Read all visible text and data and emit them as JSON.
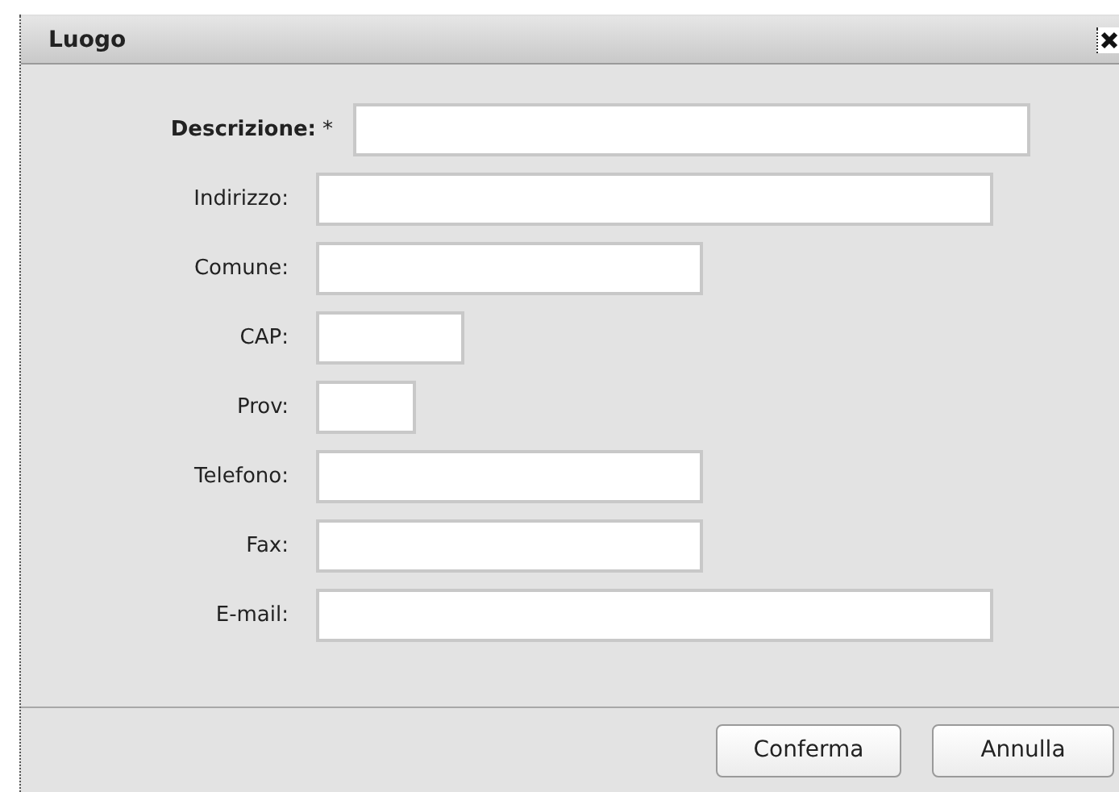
{
  "window": {
    "title": "Luogo"
  },
  "fields": [
    {
      "label": "Descrizione:",
      "required": true,
      "required_mark": "*",
      "kind": "wide"
    },
    {
      "label": "Indirizzo:",
      "required": false,
      "kind": "wide"
    },
    {
      "label": "Comune:",
      "required": false,
      "kind": "medium"
    },
    {
      "label": "CAP:",
      "required": false,
      "kind": "small"
    },
    {
      "label": "Prov:",
      "required": false,
      "kind": "tiny"
    },
    {
      "label": "Telefono:",
      "required": false,
      "kind": "medium"
    },
    {
      "label": "Fax:",
      "required": false,
      "kind": "medium"
    },
    {
      "label": "E-mail:",
      "required": false,
      "kind": "wide"
    }
  ],
  "buttons": [
    "Conferma",
    "Annulla"
  ]
}
